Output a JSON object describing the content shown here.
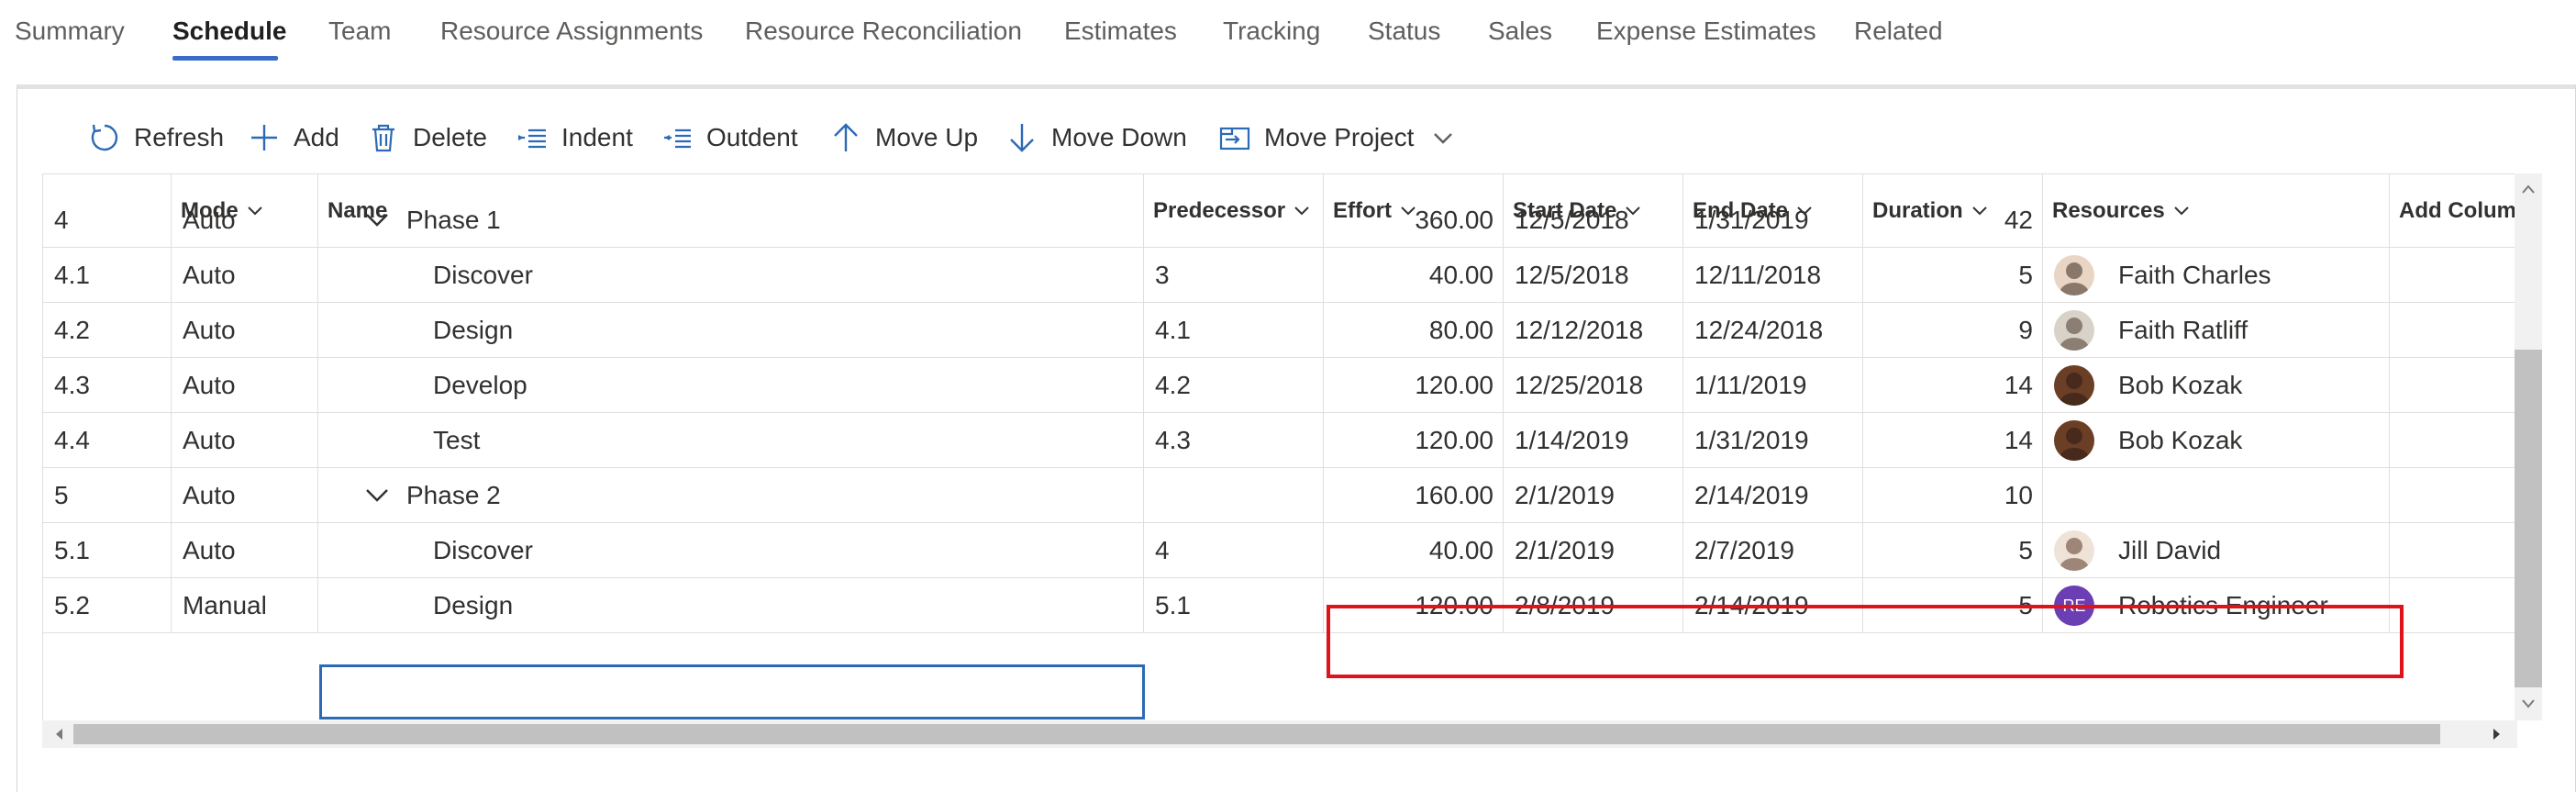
{
  "tabs": [
    {
      "label": "Summary",
      "active": false
    },
    {
      "label": "Schedule",
      "active": true
    },
    {
      "label": "Team",
      "active": false
    },
    {
      "label": "Resource Assignments",
      "active": false
    },
    {
      "label": "Resource Reconciliation",
      "active": false
    },
    {
      "label": "Estimates",
      "active": false
    },
    {
      "label": "Tracking",
      "active": false
    },
    {
      "label": "Status",
      "active": false
    },
    {
      "label": "Sales",
      "active": false
    },
    {
      "label": "Expense Estimates",
      "active": false
    },
    {
      "label": "Related",
      "active": false
    }
  ],
  "toolbar": {
    "refresh": "Refresh",
    "add": "Add",
    "delete": "Delete",
    "indent": "Indent",
    "outdent": "Outdent",
    "move_up": "Move Up",
    "move_down": "Move Down",
    "move_project": "Move Project"
  },
  "columns": {
    "mode": "Mode",
    "name": "Name",
    "predecessor": "Predecessor",
    "effort": "Effort",
    "start_date": "Start Date",
    "end_date": "End Date",
    "duration": "Duration",
    "resources": "Resources",
    "add_column": "Add Colum"
  },
  "rows": [
    {
      "id": "4",
      "mode": "Auto",
      "name": "Phase 1",
      "predecessor": "",
      "effort": "360.00",
      "start": "12/5/2018",
      "end": "1/31/2019",
      "duration": "42",
      "resource": "",
      "summary": true
    },
    {
      "id": "4.1",
      "mode": "Auto",
      "name": "Discover",
      "predecessor": "3",
      "effort": "40.00",
      "start": "12/5/2018",
      "end": "12/11/2018",
      "duration": "5",
      "resource": "Faith Charles"
    },
    {
      "id": "4.2",
      "mode": "Auto",
      "name": "Design",
      "predecessor": "4.1",
      "effort": "80.00",
      "start": "12/12/2018",
      "end": "12/24/2018",
      "duration": "9",
      "resource": "Faith Ratliff"
    },
    {
      "id": "4.3",
      "mode": "Auto",
      "name": "Develop",
      "predecessor": "4.2",
      "effort": "120.00",
      "start": "12/25/2018",
      "end": "1/11/2019",
      "duration": "14",
      "resource": "Bob Kozak"
    },
    {
      "id": "4.4",
      "mode": "Auto",
      "name": "Test",
      "predecessor": "4.3",
      "effort": "120.00",
      "start": "1/14/2019",
      "end": "1/31/2019",
      "duration": "14",
      "resource": "Bob Kozak"
    },
    {
      "id": "5",
      "mode": "Auto",
      "name": "Phase 2",
      "predecessor": "",
      "effort": "160.00",
      "start": "2/1/2019",
      "end": "2/14/2019",
      "duration": "10",
      "resource": "",
      "summary": true
    },
    {
      "id": "5.1",
      "mode": "Auto",
      "name": "Discover",
      "predecessor": "4",
      "effort": "40.00",
      "start": "2/1/2019",
      "end": "2/7/2019",
      "duration": "5",
      "resource": "Jill David"
    },
    {
      "id": "5.2",
      "mode": "Manual",
      "name": "Design",
      "predecessor": "5.1",
      "effort": "120.00",
      "start": "2/8/2019",
      "end": "2/14/2019",
      "duration": "5",
      "resource": "Robotics Engineer",
      "initials": "RE"
    }
  ],
  "colors": {
    "accent": "#3a6cc7",
    "highlight": "#e0121b",
    "edit_border": "#2d6ab5",
    "initials_avatar": "#6b3fb3"
  }
}
